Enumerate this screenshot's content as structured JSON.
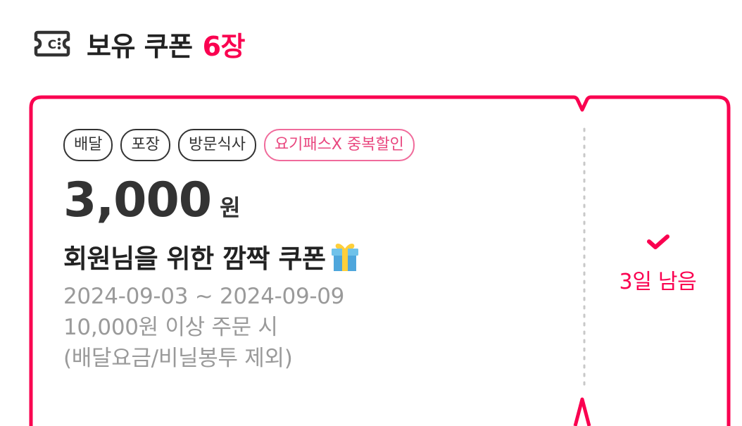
{
  "header": {
    "icon": "coupon-ticket-icon",
    "title": "보유 쿠폰",
    "count": "6장"
  },
  "coupon": {
    "tags": [
      {
        "label": "배달"
      },
      {
        "label": "포장"
      },
      {
        "label": "방문식사"
      },
      {
        "label": "요기패스X 중복할인"
      }
    ],
    "amount": "3,000",
    "unit": "원",
    "name": "회원님을 위한 깜짝 쿠폰",
    "name_icon": "gift-icon",
    "period": "2024-09-03 ~ 2024-09-09",
    "min_order": "10,000원 이상 주문 시",
    "exclusion": "(배달요금/비닐봉투 제외)",
    "status_icon": "check-icon",
    "remaining": "3일 남음"
  },
  "colors": {
    "accent": "#fa0050",
    "tag_accent": "#e9477f",
    "text_dark": "#222222",
    "text_muted": "#9a9a9a"
  }
}
